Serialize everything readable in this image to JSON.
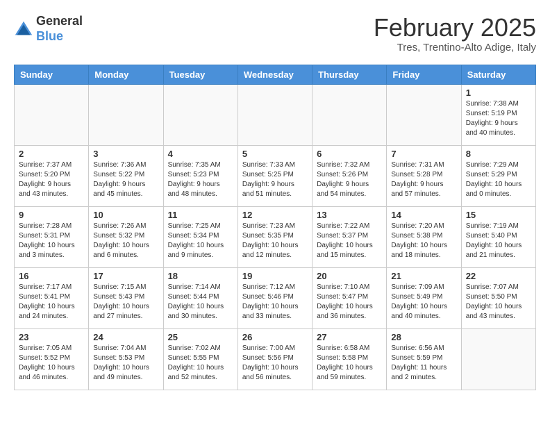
{
  "header": {
    "logo_general": "General",
    "logo_blue": "Blue",
    "month_title": "February 2025",
    "location": "Tres, Trentino-Alto Adige, Italy"
  },
  "weekdays": [
    "Sunday",
    "Monday",
    "Tuesday",
    "Wednesday",
    "Thursday",
    "Friday",
    "Saturday"
  ],
  "weeks": [
    [
      {
        "day": "",
        "info": ""
      },
      {
        "day": "",
        "info": ""
      },
      {
        "day": "",
        "info": ""
      },
      {
        "day": "",
        "info": ""
      },
      {
        "day": "",
        "info": ""
      },
      {
        "day": "",
        "info": ""
      },
      {
        "day": "1",
        "info": "Sunrise: 7:38 AM\nSunset: 5:19 PM\nDaylight: 9 hours\nand 40 minutes."
      }
    ],
    [
      {
        "day": "2",
        "info": "Sunrise: 7:37 AM\nSunset: 5:20 PM\nDaylight: 9 hours\nand 43 minutes."
      },
      {
        "day": "3",
        "info": "Sunrise: 7:36 AM\nSunset: 5:22 PM\nDaylight: 9 hours\nand 45 minutes."
      },
      {
        "day": "4",
        "info": "Sunrise: 7:35 AM\nSunset: 5:23 PM\nDaylight: 9 hours\nand 48 minutes."
      },
      {
        "day": "5",
        "info": "Sunrise: 7:33 AM\nSunset: 5:25 PM\nDaylight: 9 hours\nand 51 minutes."
      },
      {
        "day": "6",
        "info": "Sunrise: 7:32 AM\nSunset: 5:26 PM\nDaylight: 9 hours\nand 54 minutes."
      },
      {
        "day": "7",
        "info": "Sunrise: 7:31 AM\nSunset: 5:28 PM\nDaylight: 9 hours\nand 57 minutes."
      },
      {
        "day": "8",
        "info": "Sunrise: 7:29 AM\nSunset: 5:29 PM\nDaylight: 10 hours\nand 0 minutes."
      }
    ],
    [
      {
        "day": "9",
        "info": "Sunrise: 7:28 AM\nSunset: 5:31 PM\nDaylight: 10 hours\nand 3 minutes."
      },
      {
        "day": "10",
        "info": "Sunrise: 7:26 AM\nSunset: 5:32 PM\nDaylight: 10 hours\nand 6 minutes."
      },
      {
        "day": "11",
        "info": "Sunrise: 7:25 AM\nSunset: 5:34 PM\nDaylight: 10 hours\nand 9 minutes."
      },
      {
        "day": "12",
        "info": "Sunrise: 7:23 AM\nSunset: 5:35 PM\nDaylight: 10 hours\nand 12 minutes."
      },
      {
        "day": "13",
        "info": "Sunrise: 7:22 AM\nSunset: 5:37 PM\nDaylight: 10 hours\nand 15 minutes."
      },
      {
        "day": "14",
        "info": "Sunrise: 7:20 AM\nSunset: 5:38 PM\nDaylight: 10 hours\nand 18 minutes."
      },
      {
        "day": "15",
        "info": "Sunrise: 7:19 AM\nSunset: 5:40 PM\nDaylight: 10 hours\nand 21 minutes."
      }
    ],
    [
      {
        "day": "16",
        "info": "Sunrise: 7:17 AM\nSunset: 5:41 PM\nDaylight: 10 hours\nand 24 minutes."
      },
      {
        "day": "17",
        "info": "Sunrise: 7:15 AM\nSunset: 5:43 PM\nDaylight: 10 hours\nand 27 minutes."
      },
      {
        "day": "18",
        "info": "Sunrise: 7:14 AM\nSunset: 5:44 PM\nDaylight: 10 hours\nand 30 minutes."
      },
      {
        "day": "19",
        "info": "Sunrise: 7:12 AM\nSunset: 5:46 PM\nDaylight: 10 hours\nand 33 minutes."
      },
      {
        "day": "20",
        "info": "Sunrise: 7:10 AM\nSunset: 5:47 PM\nDaylight: 10 hours\nand 36 minutes."
      },
      {
        "day": "21",
        "info": "Sunrise: 7:09 AM\nSunset: 5:49 PM\nDaylight: 10 hours\nand 40 minutes."
      },
      {
        "day": "22",
        "info": "Sunrise: 7:07 AM\nSunset: 5:50 PM\nDaylight: 10 hours\nand 43 minutes."
      }
    ],
    [
      {
        "day": "23",
        "info": "Sunrise: 7:05 AM\nSunset: 5:52 PM\nDaylight: 10 hours\nand 46 minutes."
      },
      {
        "day": "24",
        "info": "Sunrise: 7:04 AM\nSunset: 5:53 PM\nDaylight: 10 hours\nand 49 minutes."
      },
      {
        "day": "25",
        "info": "Sunrise: 7:02 AM\nSunset: 5:55 PM\nDaylight: 10 hours\nand 52 minutes."
      },
      {
        "day": "26",
        "info": "Sunrise: 7:00 AM\nSunset: 5:56 PM\nDaylight: 10 hours\nand 56 minutes."
      },
      {
        "day": "27",
        "info": "Sunrise: 6:58 AM\nSunset: 5:58 PM\nDaylight: 10 hours\nand 59 minutes."
      },
      {
        "day": "28",
        "info": "Sunrise: 6:56 AM\nSunset: 5:59 PM\nDaylight: 11 hours\nand 2 minutes."
      },
      {
        "day": "",
        "info": ""
      }
    ]
  ]
}
